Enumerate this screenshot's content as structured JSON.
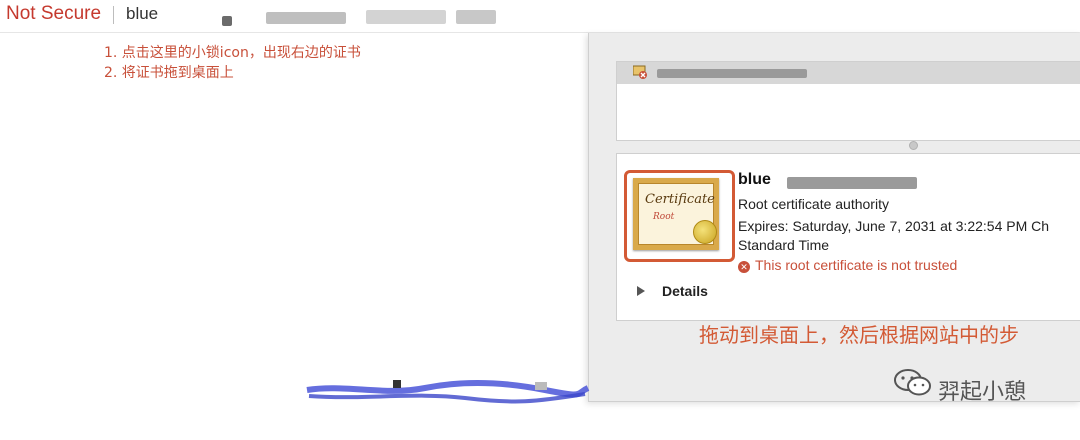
{
  "address_bar": {
    "security_label": "Not Secure",
    "url_visible": "blue"
  },
  "instructions": {
    "line1": "1. 点击这里的小锁icon，出现右边的证书",
    "line2": "2. 将证书拖到桌面上"
  },
  "certificate_panel": {
    "cert_image_title": "Certificate",
    "cert_image_subtitle": "Root",
    "name": "blue",
    "type": "Root certificate authority",
    "expires_line1": "Expires: Saturday, June 7, 2031 at 3:22:54 PM Ch",
    "expires_line2": "Standard Time",
    "trust_status": "This root certificate is not trusted",
    "details_label": "Details"
  },
  "annotation": {
    "drag_text": "拖动到桌面上，然后根据网站中的步"
  },
  "watermark": {
    "account_name": "羿起小憩"
  },
  "colors": {
    "annotation_red": "#d35a35",
    "error_red": "#c8503a"
  }
}
